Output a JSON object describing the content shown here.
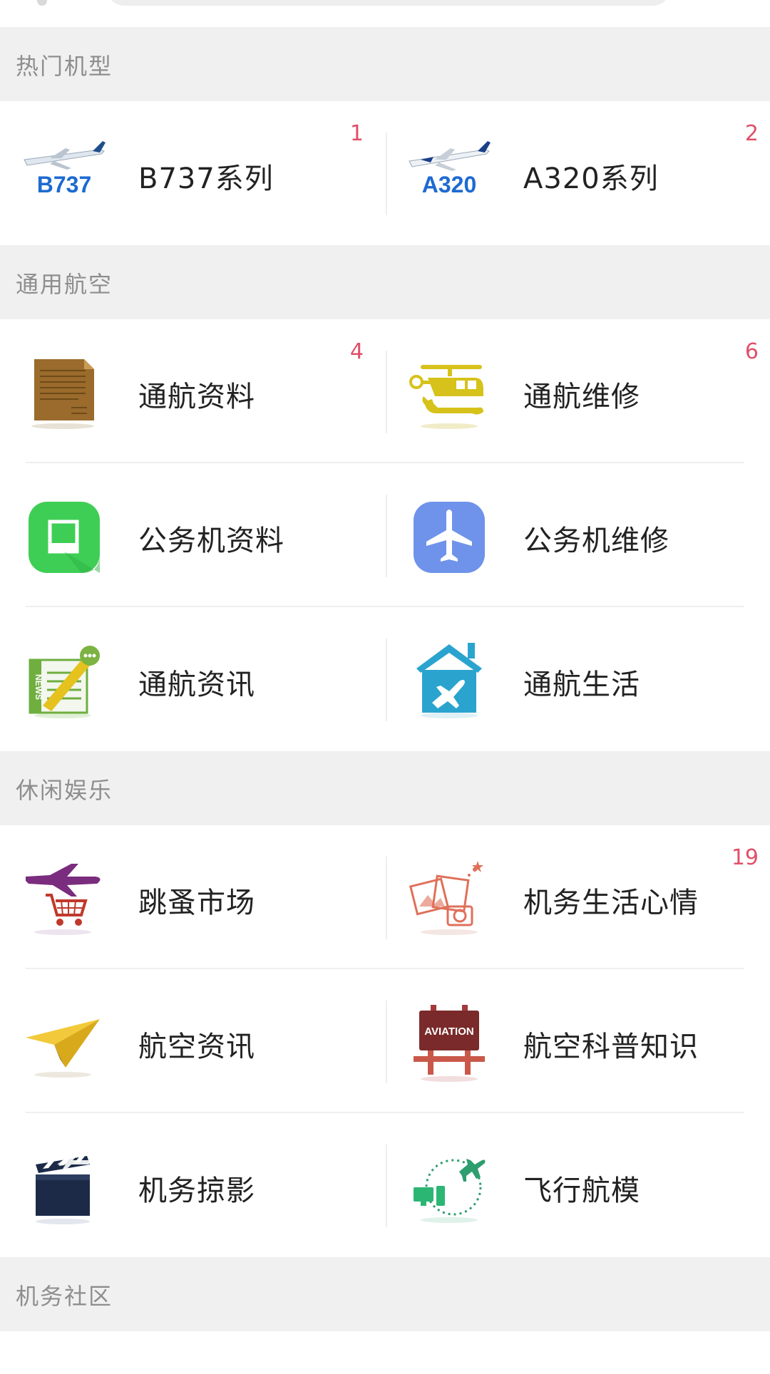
{
  "colors": {
    "badge": "#e0506a",
    "section_bg": "#f0f0f0",
    "section_text": "#8e8e8e"
  },
  "sections": [
    {
      "title": "热门机型",
      "items": [
        {
          "label": "B737系列",
          "icon": "b737-plane-logo-icon",
          "logo_text": "B737",
          "badge": "1"
        },
        {
          "label": "A320系列",
          "icon": "a320-plane-logo-icon",
          "logo_text": "A320",
          "badge": "2"
        }
      ]
    },
    {
      "title": "通用航空",
      "items": [
        {
          "label": "通航资料",
          "icon": "document-icon",
          "badge": "4"
        },
        {
          "label": "通航维修",
          "icon": "helicopter-wrench-icon",
          "badge": "6"
        },
        {
          "label": "公务机资料",
          "icon": "book-icon",
          "badge": ""
        },
        {
          "label": "公务机维修",
          "icon": "airplane-icon",
          "badge": ""
        },
        {
          "label": "通航资讯",
          "icon": "newspaper-icon",
          "logo_text": "NEWS",
          "badge": ""
        },
        {
          "label": "通航生活",
          "icon": "house-airplane-icon",
          "badge": ""
        }
      ]
    },
    {
      "title": "休闲娱乐",
      "items": [
        {
          "label": "跳蚤市场",
          "icon": "plane-shopping-cart-icon",
          "badge": ""
        },
        {
          "label": "机务生活心情",
          "icon": "photos-camera-icon",
          "badge": "19"
        },
        {
          "label": "航空资讯",
          "icon": "paper-plane-icon",
          "badge": ""
        },
        {
          "label": "航空科普知识",
          "icon": "aviation-sign-icon",
          "logo_text": "AVIATION",
          "badge": ""
        },
        {
          "label": "机务掠影",
          "icon": "clapperboard-icon",
          "badge": ""
        },
        {
          "label": "飞行航模",
          "icon": "computer-plane-icon",
          "badge": ""
        }
      ]
    },
    {
      "title": "机务社区",
      "items": []
    }
  ]
}
